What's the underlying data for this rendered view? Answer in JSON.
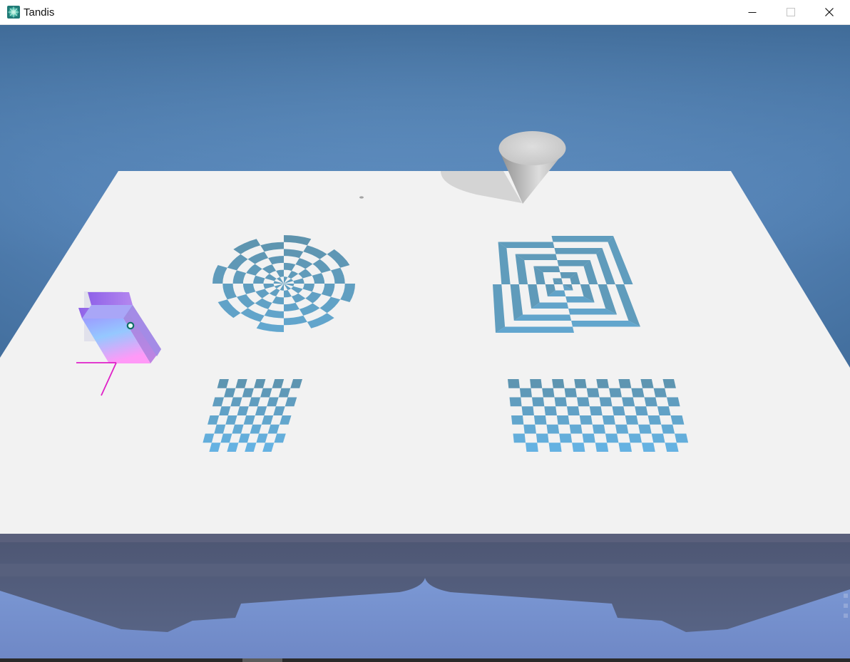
{
  "window": {
    "title": "Tandis",
    "icon": "tandis-app-icon",
    "controls": {
      "minimize": "minimize-icon",
      "maximize": "maximize-icon",
      "close": "close-icon"
    }
  },
  "scene": {
    "objects": [
      "cone",
      "radial-target-pattern",
      "square-vortex-pattern",
      "small-checkerboard",
      "large-checkerboard",
      "gradient-block",
      "axis-gizmo"
    ],
    "colors": {
      "sky_top": "#3a6592",
      "sky_mid": "#6190c4",
      "floor": "#f2f2f2",
      "pattern_dark": "#5e93ad",
      "pattern_light": "#65b4e6",
      "gizmo": "#e020c8",
      "block_top": "#9a6ee0",
      "block_bottom": "#ff9ff5"
    }
  }
}
